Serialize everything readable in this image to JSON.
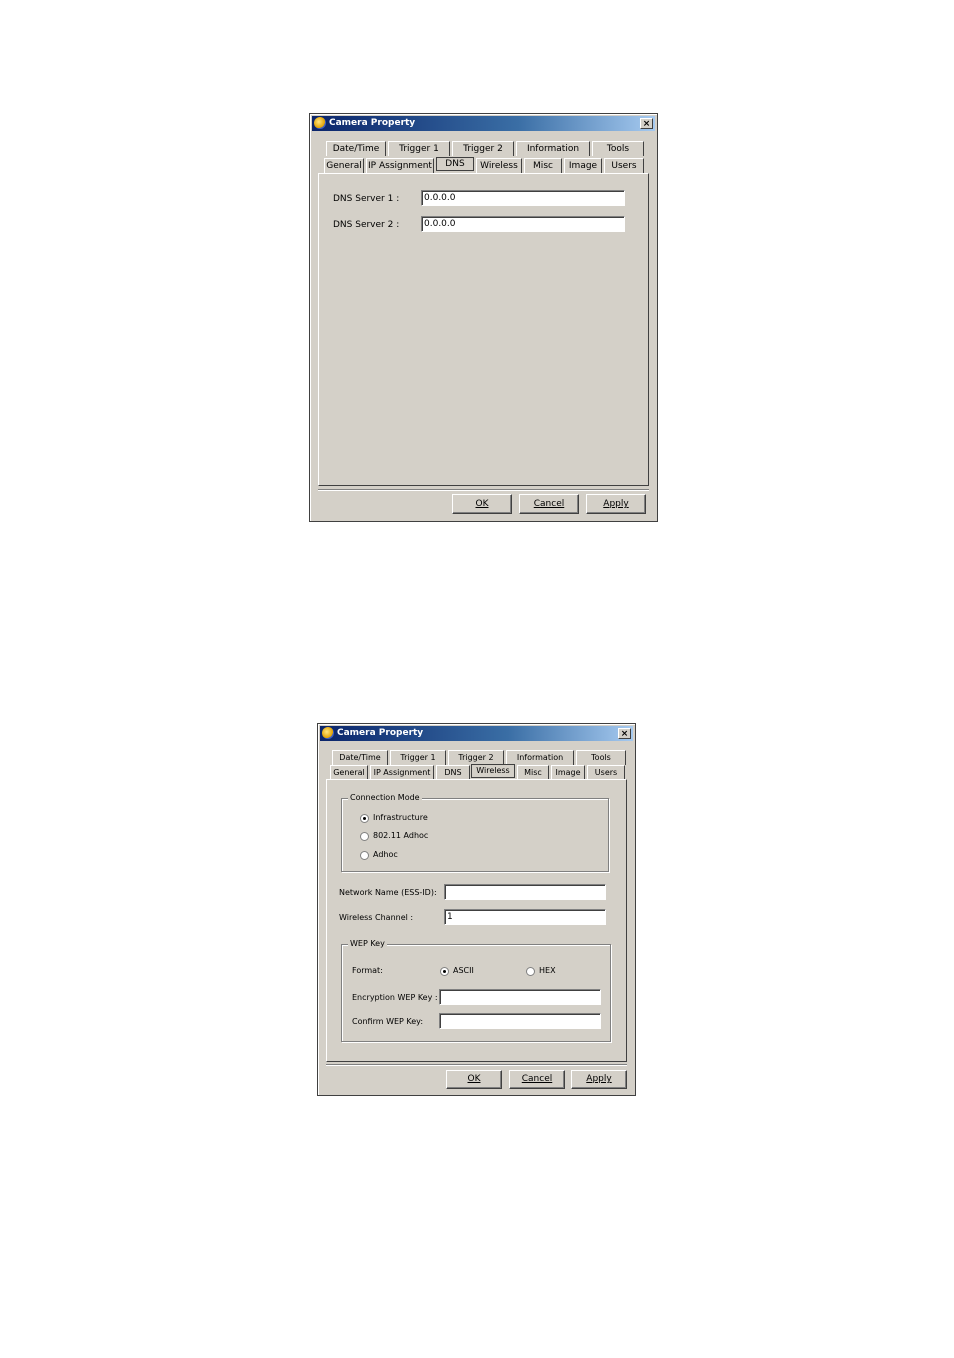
{
  "dialog1": {
    "title": "Camera Property",
    "close_label": "×",
    "tabs_top": [
      "Date/Time",
      "Trigger 1",
      "Trigger 2",
      "Information",
      "Tools"
    ],
    "tabs_bottom": [
      "General",
      "IP Assignment",
      "DNS",
      "Wireless",
      "Misc",
      "Image",
      "Users"
    ],
    "active_tab": "DNS",
    "dns1_label": "DNS Server 1 :",
    "dns1_value": "0.0.0.0",
    "dns2_label": "DNS Server 2 :",
    "dns2_value": "0.0.0.0",
    "ok": "OK",
    "cancel": "Cancel",
    "apply": "Apply"
  },
  "dialog2": {
    "title": "Camera Property",
    "close_label": "×",
    "tabs_top": [
      "Date/Time",
      "Trigger 1",
      "Trigger 2",
      "Information",
      "Tools"
    ],
    "tabs_bottom": [
      "General",
      "IP Assignment",
      "DNS",
      "Wireless",
      "Misc",
      "Image",
      "Users"
    ],
    "active_tab": "Wireless",
    "connection_mode_label": "Connection Mode",
    "mode_infrastructure": "Infrastructure",
    "mode_80211_adhoc": "802.11 Adhoc",
    "mode_adhoc": "Adhoc",
    "network_name_label": "Network Name (ESS-ID):",
    "network_name_value": "",
    "wireless_channel_label": "Wireless Channel :",
    "wireless_channel_value": "1",
    "wep_key_label": "WEP Key",
    "format_label": "Format:",
    "format_ascii": "ASCII",
    "format_hex": "HEX",
    "encryption_label": "Encryption WEP Key :",
    "encryption_value": "",
    "confirm_label": "Confirm WEP Key:",
    "confirm_value": "",
    "ok": "OK",
    "cancel": "Cancel",
    "apply": "Apply"
  }
}
